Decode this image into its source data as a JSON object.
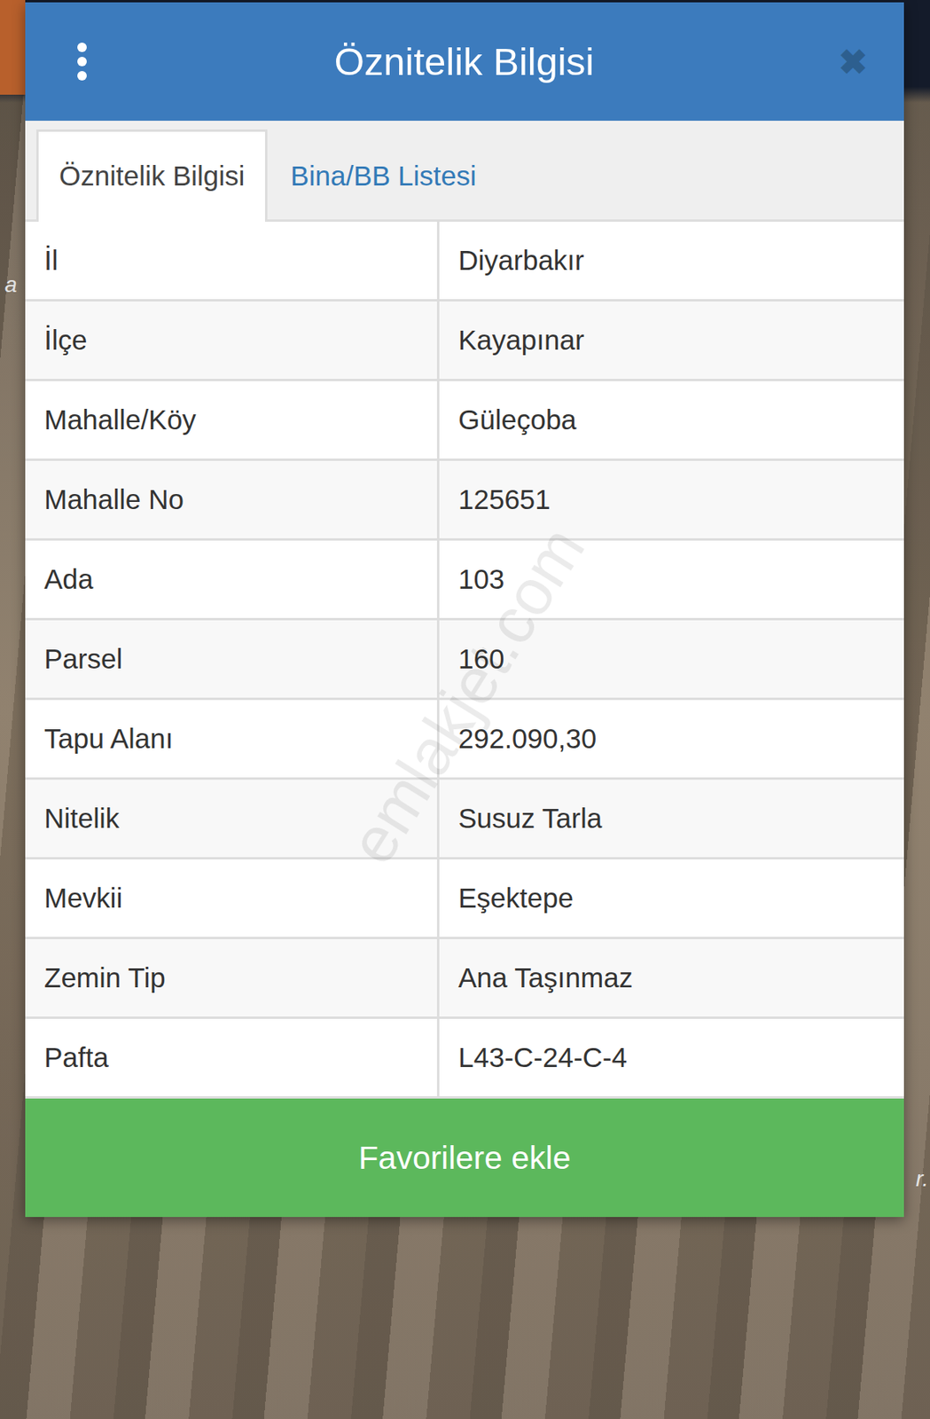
{
  "dialog": {
    "title": "Öznitelik Bilgisi",
    "close": "✖"
  },
  "tabs": [
    {
      "label": "Öznitelik Bilgisi",
      "selected": true
    },
    {
      "label": "Bina/BB Listesi",
      "selected": false
    }
  ],
  "rows": [
    {
      "label": "İl",
      "value": "Diyarbakır"
    },
    {
      "label": "İlçe",
      "value": "Kayapınar"
    },
    {
      "label": "Mahalle/Köy",
      "value": "Güleçoba"
    },
    {
      "label": "Mahalle No",
      "value": "125651"
    },
    {
      "label": "Ada",
      "value": "103"
    },
    {
      "label": "Parsel",
      "value": "160"
    },
    {
      "label": "Tapu Alanı",
      "value": "292.090,30"
    },
    {
      "label": "Nitelik",
      "value": "Susuz Tarla"
    },
    {
      "label": "Mevkii",
      "value": "Eşektepe"
    },
    {
      "label": "Zemin Tip",
      "value": "Ana Taşınmaz"
    },
    {
      "label": "Pafta",
      "value": "L43-C-24-C-4"
    }
  ],
  "button": "Favorilere ekle",
  "watermark": "emlakjet.com",
  "map_labels": [
    "a",
    "r."
  ]
}
